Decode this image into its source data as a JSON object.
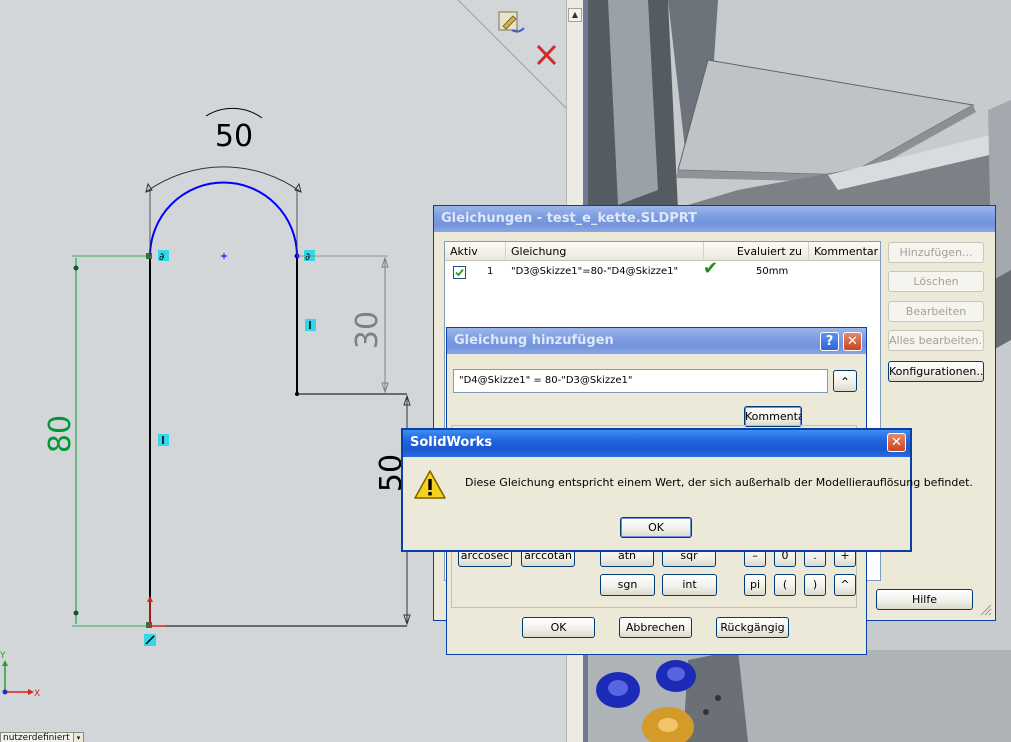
{
  "sketch": {
    "dim_top": "50",
    "dim_left": "80",
    "dim_right_upper": "30",
    "dim_right_lower": "50",
    "axis_y": "Y",
    "axis_x": "X",
    "status_field": "nutzerdefiniert"
  },
  "colors": {
    "arc": "#0000ff",
    "dim_green": "#009933",
    "dim_gray": "#808080",
    "accent": "#0a3fa8"
  },
  "equations_window": {
    "title": "Gleichungen - test_e_kette.SLDPRT",
    "columns": [
      "Aktiv",
      "Gleichung",
      "Evaluiert zu",
      "Kommentar"
    ],
    "rows": [
      {
        "active": true,
        "index": "1",
        "equation": "\"D3@Skizze1\"=80-\"D4@Skizze1\"",
        "status": "✔",
        "evaluated": "50mm",
        "comment": ""
      }
    ],
    "buttons": {
      "add": "Hinzufügen...",
      "delete": "Löschen",
      "edit": "Bearbeiten",
      "edit_all": "Alles bearbeiten...",
      "configurations": "Konfigurationen...",
      "help": "Hilfe"
    }
  },
  "add_window": {
    "title": "Gleichung hinzufügen",
    "help_btn": "?",
    "close_btn": "✕",
    "input_value": "\"D4@Skizze1\" = 80-\"D3@Skizze1\"",
    "expand_btn": "⌃",
    "comment_btn": "Kommentar",
    "calc_row1": [
      "arccosec",
      "arccotan",
      "atn",
      "sqr",
      "–",
      "0",
      ".",
      "+"
    ],
    "calc_row2": [
      "sgn",
      "int",
      "pi",
      "(",
      ")",
      "^"
    ],
    "ok": "OK",
    "cancel": "Abbrechen",
    "undo": "Rückgängig"
  },
  "message_box": {
    "title": "SolidWorks",
    "close_btn": "✕",
    "text": "Diese Gleichung entspricht einem Wert, der sich außerhalb der Modellierauflösung befindet.",
    "ok": "OK"
  }
}
